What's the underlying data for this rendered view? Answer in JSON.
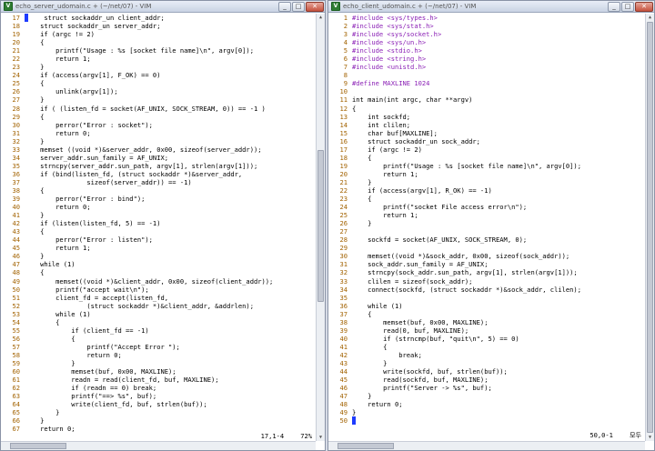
{
  "left": {
    "title": "echo_server_udomain.c + (~/net/07) - VIM",
    "status": {
      "position": "17,1-4",
      "percent": "72%"
    },
    "lines": [
      {
        "n": "17",
        "t": "    struct sockaddr_un client_addr;",
        "cur": true
      },
      {
        "n": "18",
        "t": "    struct sockaddr_un server_addr;"
      },
      {
        "n": "19",
        "t": "    if (argc != 2)"
      },
      {
        "n": "20",
        "t": "    {"
      },
      {
        "n": "21",
        "t": "        printf(\"Usage : %s [socket file name]\\n\", argv[0]);"
      },
      {
        "n": "22",
        "t": "        return 1;"
      },
      {
        "n": "23",
        "t": "    }"
      },
      {
        "n": "24",
        "t": "    if (access(argv[1], F_OK) == 0)"
      },
      {
        "n": "25",
        "t": "    {"
      },
      {
        "n": "26",
        "t": "        unlink(argv[1]);"
      },
      {
        "n": "27",
        "t": "    }"
      },
      {
        "n": "28",
        "t": "    if ( (listen_fd = socket(AF_UNIX, SOCK_STREAM, 0)) == -1 )"
      },
      {
        "n": "29",
        "t": "    {"
      },
      {
        "n": "30",
        "t": "        perror(\"Error : socket\");"
      },
      {
        "n": "31",
        "t": "        return 0;"
      },
      {
        "n": "32",
        "t": "    }"
      },
      {
        "n": "33",
        "t": "    memset ((void *)&server_addr, 0x00, sizeof(server_addr));"
      },
      {
        "n": "34",
        "t": "    server_addr.sun_family = AF_UNIX;"
      },
      {
        "n": "35",
        "t": "    strncpy(server_addr.sun_path, argv[1], strlen(argv[1]));"
      },
      {
        "n": "36",
        "t": "    if (bind(listen_fd, (struct sockaddr *)&server_addr,"
      },
      {
        "n": "37",
        "t": "                sizeof(server_addr)) == -1)"
      },
      {
        "n": "38",
        "t": "    {"
      },
      {
        "n": "39",
        "t": "        perror(\"Error : bind\");"
      },
      {
        "n": "40",
        "t": "        return 0;"
      },
      {
        "n": "41",
        "t": "    }"
      },
      {
        "n": "42",
        "t": "    if (listen(listen_fd, 5) == -1)"
      },
      {
        "n": "43",
        "t": "    {"
      },
      {
        "n": "44",
        "t": "        perror(\"Error : listen\");"
      },
      {
        "n": "45",
        "t": "        return 1;"
      },
      {
        "n": "46",
        "t": "    }"
      },
      {
        "n": "47",
        "t": "    while (1)"
      },
      {
        "n": "48",
        "t": "    {"
      },
      {
        "n": "49",
        "t": "        memset((void *)&client_addr, 0x00, sizeof(client_addr));"
      },
      {
        "n": "50",
        "t": "        printf(\"accept wait\\n\");"
      },
      {
        "n": "51",
        "t": "        client_fd = accept(listen_fd,"
      },
      {
        "n": "52",
        "t": "                (struct sockaddr *)&client_addr, &addrlen);"
      },
      {
        "n": "53",
        "t": "        while (1)"
      },
      {
        "n": "54",
        "t": "        {"
      },
      {
        "n": "55",
        "t": "            if (client_fd == -1)"
      },
      {
        "n": "56",
        "t": "            {"
      },
      {
        "n": "57",
        "t": "                printf(\"Accept Error \");"
      },
      {
        "n": "58",
        "t": "                return 0;"
      },
      {
        "n": "59",
        "t": "            }"
      },
      {
        "n": "60",
        "t": "            memset(buf, 0x00, MAXLINE);"
      },
      {
        "n": "61",
        "t": "            readn = read(client_fd, buf, MAXLINE);"
      },
      {
        "n": "62",
        "t": "            if (readn == 0) break;"
      },
      {
        "n": "63",
        "t": "            printf(\"==> %s\", buf);"
      },
      {
        "n": "64",
        "t": "            write(client_fd, buf, strlen(buf));"
      },
      {
        "n": "65",
        "t": "        }"
      },
      {
        "n": "66",
        "t": "    }"
      },
      {
        "n": "67",
        "t": "    return 0;"
      }
    ]
  },
  "right": {
    "title": "echo_client_udomain.c + (~/net/07) - VIM",
    "status": {
      "position": "50,0-1",
      "percent": "모두"
    },
    "lines": [
      {
        "n": "1",
        "t": "#include <sys/types.h>"
      },
      {
        "n": "2",
        "t": "#include <sys/stat.h>"
      },
      {
        "n": "3",
        "t": "#include <sys/socket.h>"
      },
      {
        "n": "4",
        "t": "#include <sys/un.h>"
      },
      {
        "n": "5",
        "t": "#include <stdio.h>"
      },
      {
        "n": "6",
        "t": "#include <string.h>"
      },
      {
        "n": "7",
        "t": "#include <unistd.h>"
      },
      {
        "n": "8",
        "t": ""
      },
      {
        "n": "9",
        "t": "#define MAXLINE 1024"
      },
      {
        "n": "10",
        "t": ""
      },
      {
        "n": "11",
        "t": "int main(int argc, char **argv)"
      },
      {
        "n": "12",
        "t": "{"
      },
      {
        "n": "13",
        "t": "    int sockfd;"
      },
      {
        "n": "14",
        "t": "    int clilen;"
      },
      {
        "n": "15",
        "t": "    char buf[MAXLINE];"
      },
      {
        "n": "16",
        "t": "    struct sockaddr_un sock_addr;"
      },
      {
        "n": "17",
        "t": "    if (argc != 2)"
      },
      {
        "n": "18",
        "t": "    {"
      },
      {
        "n": "19",
        "t": "        printf(\"Usage : %s [socket file name]\\n\", argv[0]);"
      },
      {
        "n": "20",
        "t": "        return 1;"
      },
      {
        "n": "21",
        "t": "    }"
      },
      {
        "n": "22",
        "t": "    if (access(argv[1], R_OK) == -1)"
      },
      {
        "n": "23",
        "t": "    {"
      },
      {
        "n": "24",
        "t": "        printf(\"socket File access error\\n\");"
      },
      {
        "n": "25",
        "t": "        return 1;"
      },
      {
        "n": "26",
        "t": "    }"
      },
      {
        "n": "27",
        "t": ""
      },
      {
        "n": "28",
        "t": "    sockfd = socket(AF_UNIX, SOCK_STREAM, 0);"
      },
      {
        "n": "29",
        "t": ""
      },
      {
        "n": "30",
        "t": "    memset((void *)&sock_addr, 0x00, sizeof(sock_addr));"
      },
      {
        "n": "31",
        "t": "    sock_addr.sun_family = AF_UNIX;"
      },
      {
        "n": "32",
        "t": "    strncpy(sock_addr.sun_path, argv[1], strlen(argv[1]));"
      },
      {
        "n": "33",
        "t": "    clilen = sizeof(sock_addr);"
      },
      {
        "n": "34",
        "t": "    connect(sockfd, (struct sockaddr *)&sock_addr, clilen);"
      },
      {
        "n": "35",
        "t": ""
      },
      {
        "n": "36",
        "t": "    while (1)"
      },
      {
        "n": "37",
        "t": "    {"
      },
      {
        "n": "38",
        "t": "        memset(buf, 0x00, MAXLINE);"
      },
      {
        "n": "39",
        "t": "        read(0, buf, MAXLINE);"
      },
      {
        "n": "40",
        "t": "        if (strncmp(buf, \"quit\\n\", 5) == 0)"
      },
      {
        "n": "41",
        "t": "        {"
      },
      {
        "n": "42",
        "t": "            break;"
      },
      {
        "n": "43",
        "t": "        }"
      },
      {
        "n": "44",
        "t": "        write(sockfd, buf, strlen(buf));"
      },
      {
        "n": "45",
        "t": "        read(sockfd, buf, MAXLINE);"
      },
      {
        "n": "46",
        "t": "        printf(\"Server -> %s\", buf);"
      },
      {
        "n": "47",
        "t": "    }"
      },
      {
        "n": "48",
        "t": "    return 0;"
      },
      {
        "n": "49",
        "t": "}"
      },
      {
        "n": "50",
        "t": "",
        "cur": true
      }
    ]
  }
}
